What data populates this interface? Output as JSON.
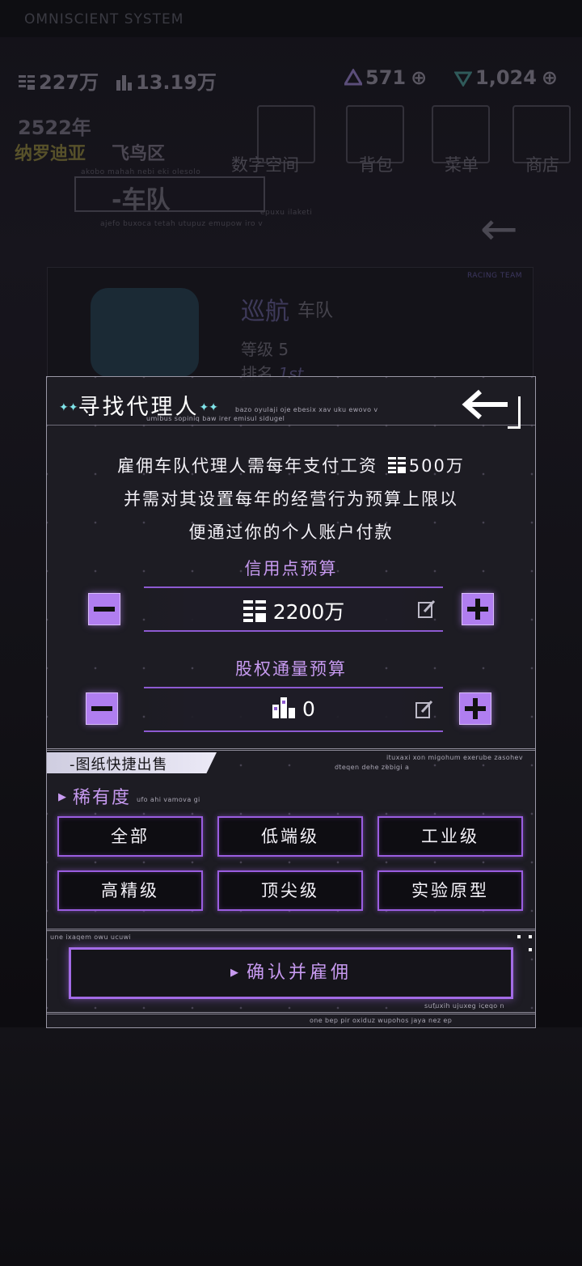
{
  "background": {
    "system_title": "OMNISCIENT SYSTEM",
    "currency_amount": "227万",
    "shares_amount": "13.19万",
    "gem_a": "571",
    "gem_b": "1,024",
    "year": "2522年",
    "region": "纳罗迪亚",
    "district": "飞鸟区",
    "team_tag": "-车队",
    "menu": [
      "数字空间",
      "背包",
      "菜单",
      "商店"
    ],
    "team_name": "巡航",
    "team_suffix": "车队",
    "level_label": "等级",
    "level_value": "5",
    "rank_label": "排名",
    "rank_value": "1st",
    "racing_team": "RACING TEAM",
    "tiny_texts": {
      "t1": "akobo mahah nebi eki olesolo",
      "t2": "epuxu ilaketi",
      "t3": "ajefo buxoca tetah utupuz emupow iro v"
    }
  },
  "dialog": {
    "title": "寻找代理人",
    "subtitle_line1": "bazo oyulaji oje ebesix xav uku ewovo v",
    "subtitle_line2": "umibus sopiniq baw irer emisul sidugel",
    "description": [
      "雇佣车队代理人需每年支付工资",
      "500万",
      "并需对其设置每年的经营行为预算上限以",
      "便通过你的个人账户付款"
    ],
    "credit_budget": {
      "label": "信用点预算",
      "value": "2200万"
    },
    "equity_budget": {
      "label": "股权通量预算",
      "value": "0"
    },
    "quick_sell": {
      "tab_label": "-图纸快捷出售",
      "tiny_line1": "ituxaxi xon migohum exerube zasohev",
      "tiny_line2": "oteqen dehe zebigi a",
      "rarity_label": "稀有度",
      "rarity_tiny": "ufo ahi vamova gi",
      "filters": [
        "全部",
        "低端级",
        "工业级",
        "高精级",
        "顶尖级",
        "实验原型"
      ]
    },
    "footer": {
      "tiny_top": "une ixaqem owu ucuwi",
      "confirm_label": "确认并雇佣",
      "tiny_right": "sufuxih ujuxeg iceqo n",
      "tiny_bottom": "one bep pir oxiduz wupohos jaya nez ep"
    }
  },
  "colors": {
    "accent_purple": "#b07ef0",
    "label_purple": "#c79af0",
    "sparkle_cyan": "#7fe3e8"
  }
}
